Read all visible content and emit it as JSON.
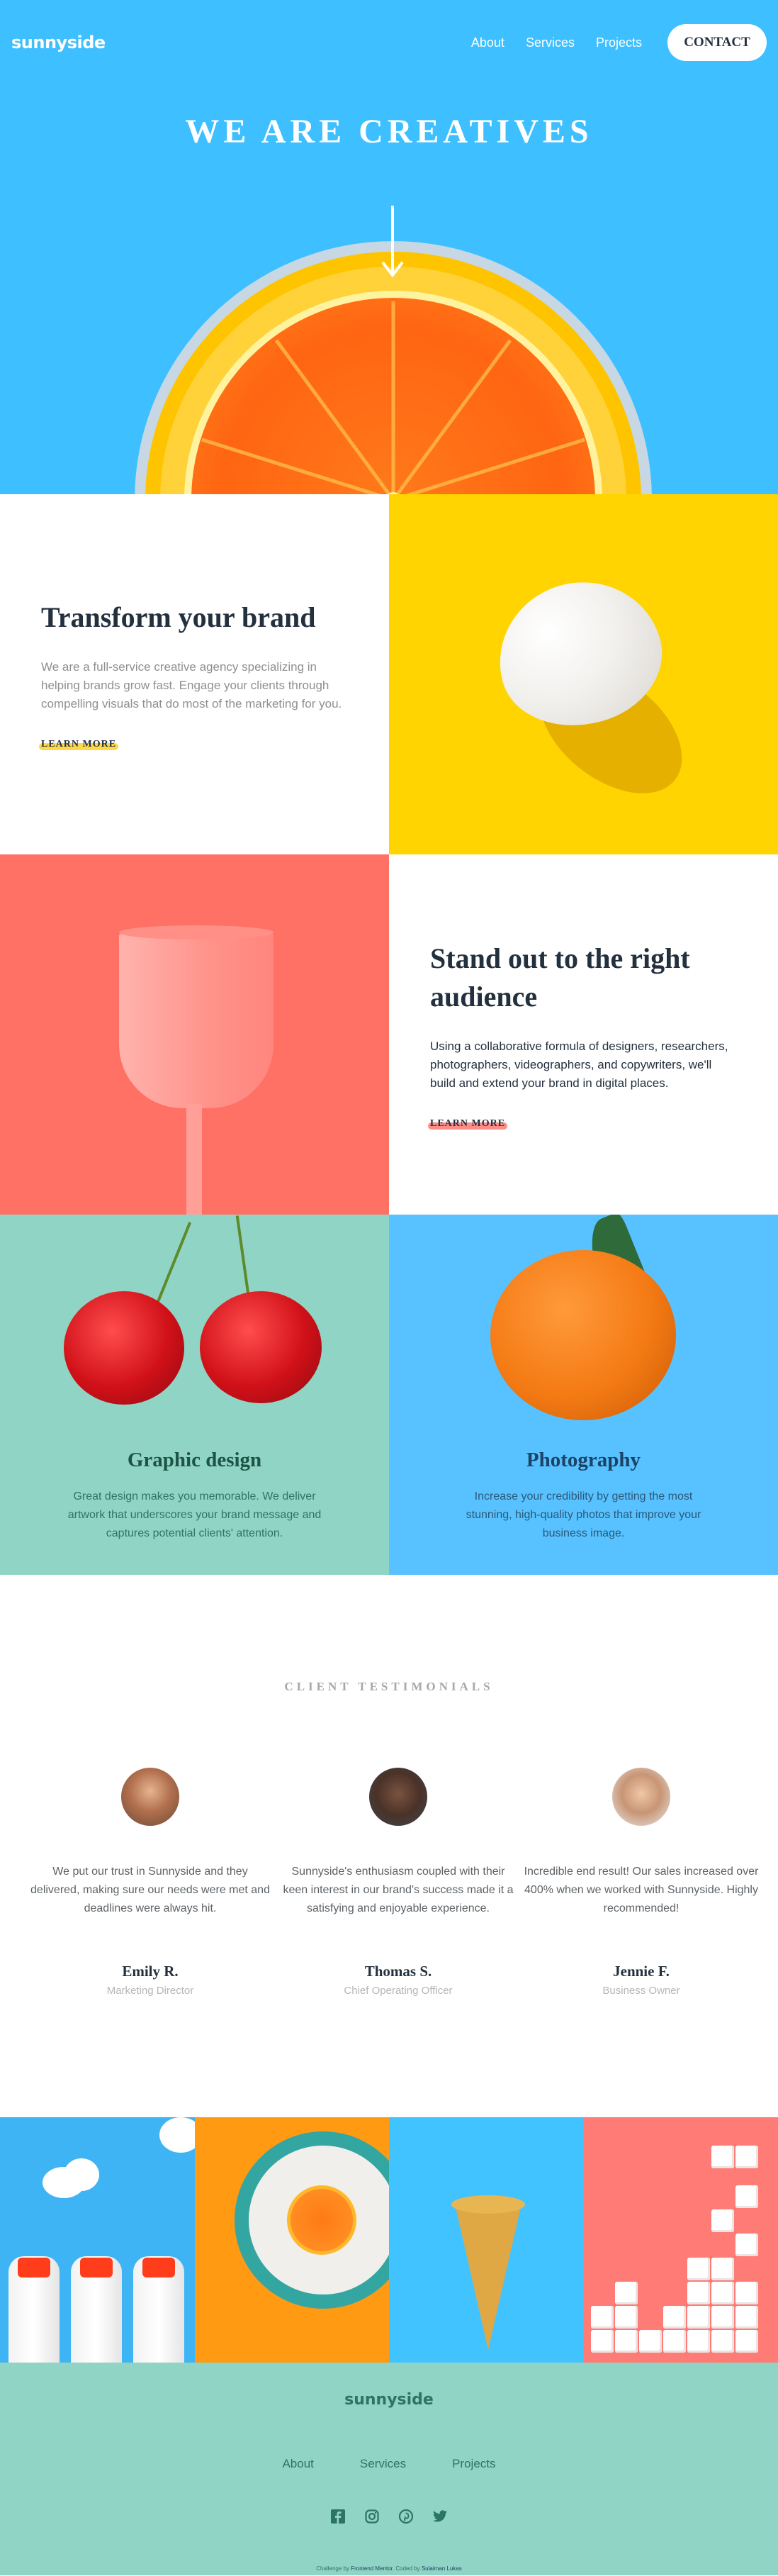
{
  "header": {
    "logo": "sunnyside",
    "nav": [
      "About",
      "Services",
      "Projects"
    ],
    "contact_label": "CONTACT"
  },
  "hero": {
    "title": "WE ARE CREATIVES"
  },
  "features": [
    {
      "title": "Transform your brand",
      "body": "We are a full-service creative agency specializing in helping brands grow fast. Engage your clients through compelling visuals that do most of the marketing for you.",
      "link": "LEARN MORE",
      "underline_color": "#fdd94a"
    },
    {
      "title": "Stand out to the right audience",
      "body": "Using a collaborative formula of designers, researchers, photographers, videographers, and copywriters, we'll build and extend your brand in digital places.",
      "link": "LEARN MORE",
      "underline_color": "#fd8c87"
    }
  ],
  "services": [
    {
      "title": "Graphic design",
      "body": "Great design makes you memorable. We deliver artwork that underscores your brand message and captures potential clients' attention."
    },
    {
      "title": "Photography",
      "body": "Increase your credibility by getting the most stunning, high-quality photos that improve your business image."
    }
  ],
  "testimonials": {
    "heading": "CLIENT TESTIMONIALS",
    "items": [
      {
        "quote": "We put our trust in Sunnyside and they delivered, making sure our needs were met and deadlines were always hit.",
        "name": "Emily R.",
        "role": "Marketing Director"
      },
      {
        "quote": "Sunnyside's enthusiasm coupled with their keen interest in our brand's success made it a satisfying and enjoyable experience.",
        "name": "Thomas S.",
        "role": "Chief Operating Officer"
      },
      {
        "quote": "Incredible end result! Our sales increased over 400% when we worked with Sunnyside. Highly recommended!",
        "name": "Jennie F.",
        "role": "Business Owner"
      }
    ]
  },
  "footer": {
    "logo": "sunnyside",
    "links": [
      "About",
      "Services",
      "Projects"
    ],
    "social": [
      "facebook-icon",
      "instagram-icon",
      "pinterest-icon",
      "twitter-icon"
    ],
    "attribution_prefix": "Challenge by ",
    "attribution_fm": "Frontend Mentor",
    "attribution_mid": ". Coded by ",
    "attribution_author": "Sulaiman Lukas"
  },
  "colors": {
    "hero_bg": "#3ebfff",
    "egg_bg": "#ffd400",
    "cup_bg": "#ff7065",
    "mint": "#90d4c5",
    "sky": "#57c2ff",
    "dark_text": "#23303e"
  }
}
